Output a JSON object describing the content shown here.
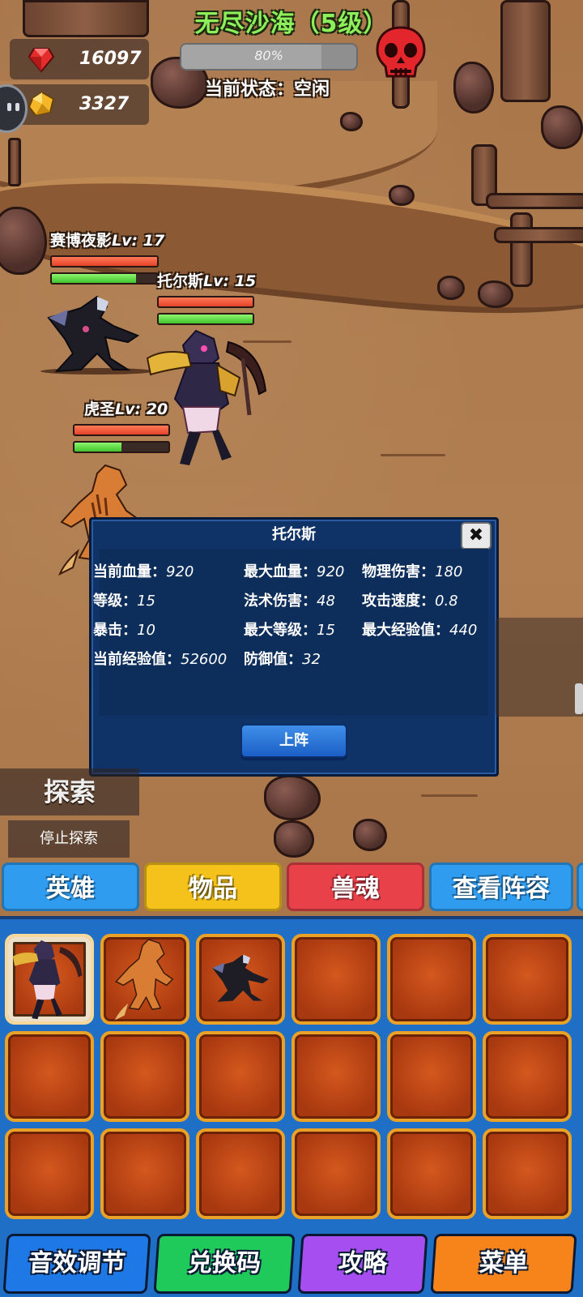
{
  "hud": {
    "level_title": "无尽沙海（5级）",
    "progress_text": "80%",
    "progress_fraction": 0.8,
    "status_text": "当前状态：空闲",
    "resources": [
      {
        "icon": "ruby-gem-icon",
        "value": "16097"
      },
      {
        "icon": "gold-gem-icon",
        "value": "3327"
      }
    ]
  },
  "heroes_on_field": [
    {
      "name": "赛博夜影",
      "level_text": "Lv: 17",
      "hp": 1.0,
      "xp": 0.8
    },
    {
      "name": "托尔斯",
      "level_text": "Lv: 15",
      "hp": 1.0,
      "xp": 1.0
    },
    {
      "name": "虎圣",
      "level_text": "Lv: 20",
      "hp": 1.0,
      "xp": 0.5
    }
  ],
  "dialog": {
    "title": "托尔斯",
    "close_icon": "close-x-icon",
    "stats": [
      {
        "label": "当前血量：",
        "value": "920"
      },
      {
        "label": "最大血量：",
        "value": "920"
      },
      {
        "label": "物理伤害：",
        "value": "180"
      },
      {
        "label": "等级：",
        "value": "15"
      },
      {
        "label": "法术伤害：",
        "value": "48"
      },
      {
        "label": "攻击速度：",
        "value": "0.8"
      },
      {
        "label": "暴击：",
        "value": "10"
      },
      {
        "label": "最大等级：",
        "value": "15"
      },
      {
        "label": "最大经验值：",
        "value": "440"
      },
      {
        "label": "当前经验值：",
        "value": "52600"
      },
      {
        "label": "防御值：",
        "value": "32"
      }
    ],
    "deploy_label": "上阵"
  },
  "explore": {
    "title": "探索",
    "stop_label": "停止探索"
  },
  "tabs": [
    {
      "label": "英雄",
      "color": "#2f9cf0"
    },
    {
      "label": "物品",
      "color": "#f5c21b"
    },
    {
      "label": "兽魂",
      "color": "#e8414a"
    },
    {
      "label": "查看阵容",
      "color": "#2f9cf0"
    }
  ],
  "inventory": {
    "rows": 3,
    "cols": 6,
    "items": [
      "托尔斯",
      "虎圣",
      "赛博夜影"
    ]
  },
  "bottom_buttons": [
    {
      "label": "音效调节",
      "color": "#1e78e6"
    },
    {
      "label": "兑换码",
      "color": "#1fc95a"
    },
    {
      "label": "攻略",
      "color": "#a74ef0"
    },
    {
      "label": "菜单",
      "color": "#f7841a"
    }
  ]
}
